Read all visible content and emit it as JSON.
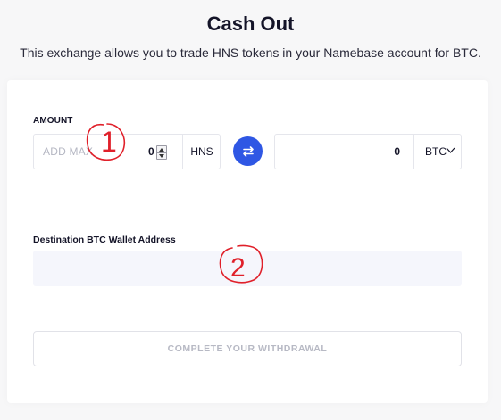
{
  "header": {
    "title": "Cash Out",
    "subtitle": "This exchange allows you to trade HNS tokens in your Namebase account for BTC."
  },
  "amount": {
    "label": "AMOUNT",
    "hns_placeholder": "ADD MAX",
    "hns_value": "0",
    "hns_unit": "HNS",
    "btc_value": "0",
    "btc_unit": "BTC"
  },
  "destination": {
    "label": "Destination BTC Wallet Address",
    "value": ""
  },
  "complete_button_label": "COMPLETE YOUR WITHDRAWAL",
  "annotations": {
    "first": "1",
    "second": "2"
  },
  "colors": {
    "accent": "#2f57e4",
    "annotation": "#e0202a",
    "input_bg": "#f5f6fc"
  },
  "icons": {
    "swap": "swap-arrows-icon",
    "dropdown": "chevron-down-icon"
  }
}
